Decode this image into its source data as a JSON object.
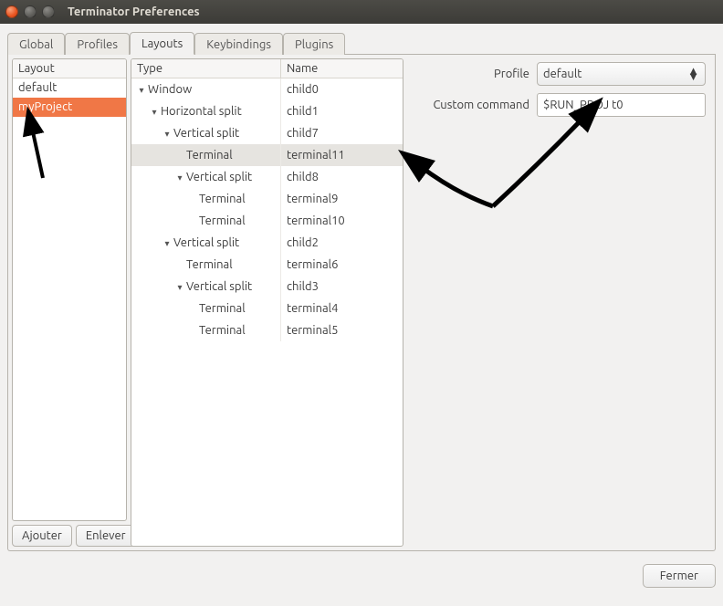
{
  "window": {
    "title": "Terminator Preferences"
  },
  "tabs": [
    "Global",
    "Profiles",
    "Layouts",
    "Keybindings",
    "Plugins"
  ],
  "active_tab": "Layouts",
  "layout_list": {
    "header": "Layout",
    "items": [
      "default",
      "myProject"
    ],
    "selected": "myProject"
  },
  "layout_buttons": {
    "add": "Ajouter",
    "remove": "Enlever"
  },
  "tree": {
    "headers": {
      "type": "Type",
      "name": "Name"
    },
    "rows": [
      {
        "indent": 0,
        "exp": true,
        "type": "Window",
        "name": "child0"
      },
      {
        "indent": 1,
        "exp": true,
        "type": "Horizontal split",
        "name": "child1"
      },
      {
        "indent": 2,
        "exp": true,
        "type": "Vertical split",
        "name": "child7"
      },
      {
        "indent": 3,
        "exp": false,
        "type": "Terminal",
        "name": "terminal11",
        "selected": true
      },
      {
        "indent": 3,
        "exp": true,
        "type": "Vertical split",
        "name": "child8"
      },
      {
        "indent": 4,
        "exp": false,
        "type": "Terminal",
        "name": "terminal9"
      },
      {
        "indent": 4,
        "exp": false,
        "type": "Terminal",
        "name": "terminal10"
      },
      {
        "indent": 2,
        "exp": true,
        "type": "Vertical split",
        "name": "child2"
      },
      {
        "indent": 3,
        "exp": false,
        "type": "Terminal",
        "name": "terminal6"
      },
      {
        "indent": 3,
        "exp": true,
        "type": "Vertical split",
        "name": "child3"
      },
      {
        "indent": 4,
        "exp": false,
        "type": "Terminal",
        "name": "terminal4"
      },
      {
        "indent": 4,
        "exp": false,
        "type": "Terminal",
        "name": "terminal5"
      }
    ]
  },
  "form": {
    "profile_label": "Profile",
    "profile_value": "default",
    "command_label": "Custom command",
    "command_value": "$RUN_PROJ t0"
  },
  "footer": {
    "close": "Fermer"
  }
}
